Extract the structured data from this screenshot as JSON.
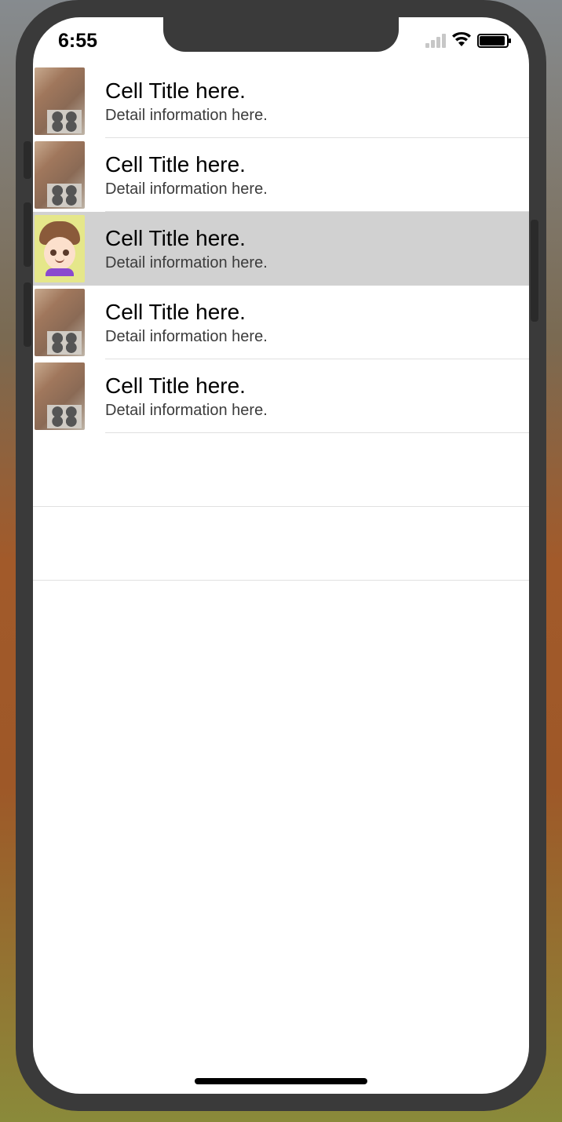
{
  "statusBar": {
    "time": "6:55"
  },
  "cells": [
    {
      "title": "Cell Title here.",
      "detail": "Detail information here.",
      "avatar": "photo",
      "selected": false
    },
    {
      "title": "Cell Title here.",
      "detail": "Detail information here.",
      "avatar": "photo",
      "selected": false
    },
    {
      "title": "Cell Title here.",
      "detail": "Detail information here.",
      "avatar": "cartoon",
      "selected": true
    },
    {
      "title": "Cell Title here.",
      "detail": "Detail information here.",
      "avatar": "photo",
      "selected": false
    },
    {
      "title": "Cell Title here.",
      "detail": "Detail information here.",
      "avatar": "photo",
      "selected": false
    }
  ]
}
